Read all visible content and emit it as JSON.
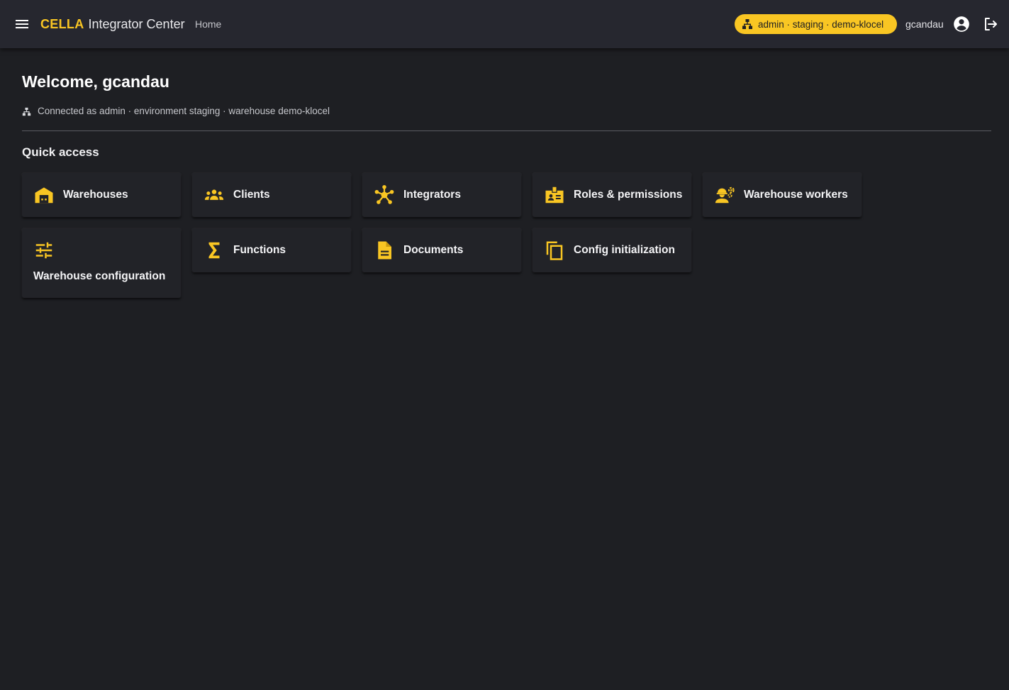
{
  "header": {
    "brand": "CELLA",
    "app_name": "Integrator Center",
    "nav_home": "Home",
    "env_chip": "admin · staging · demo-klocel",
    "username": "gcandau",
    "accent_color": "#f9c623"
  },
  "main": {
    "welcome": "Welcome, gcandau",
    "connected_as": "Connected as admin · environment staging · warehouse demo-klocel",
    "quick_access_title": "Quick access",
    "cards": [
      {
        "label": "Warehouses",
        "icon": "warehouse-icon"
      },
      {
        "label": "Clients",
        "icon": "groups-icon"
      },
      {
        "label": "Integrators",
        "icon": "hub-icon"
      },
      {
        "label": "Roles & permissions",
        "icon": "badge-icon"
      },
      {
        "label": "Warehouse workers",
        "icon": "engineering-icon"
      },
      {
        "label": "Warehouse configuration",
        "icon": "tune-icon"
      },
      {
        "label": "Functions",
        "icon": "sigma-icon"
      },
      {
        "label": "Documents",
        "icon": "document-icon"
      },
      {
        "label": "Config initialization",
        "icon": "copy-icon"
      }
    ]
  }
}
